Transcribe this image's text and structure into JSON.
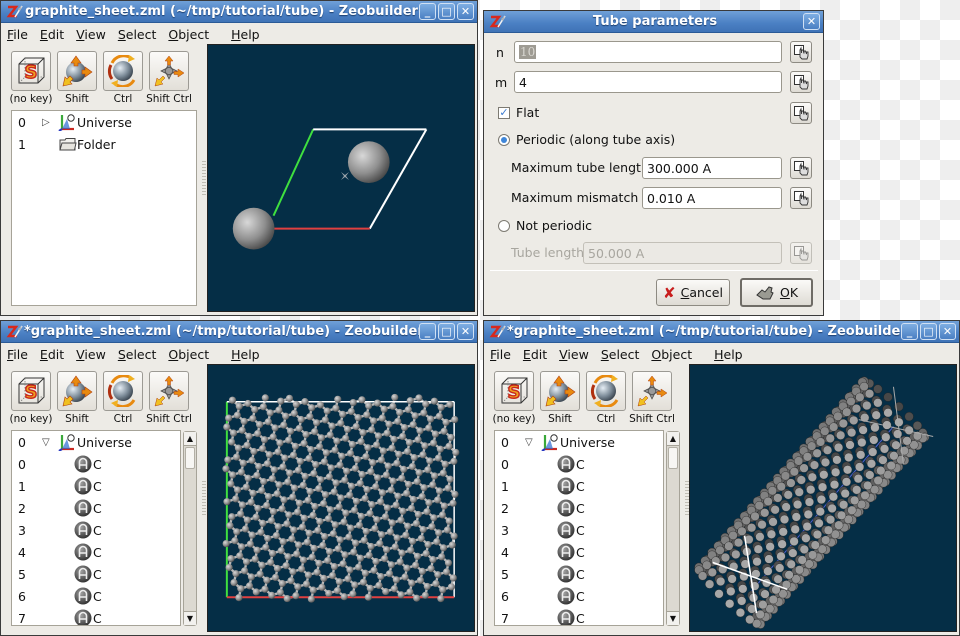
{
  "windows": [
    {
      "id": "main-window-1",
      "title": "graphite_sheet.zml (~/tmp/tutorial/tube) - Zeobuilder",
      "menu": [
        "File",
        "Edit",
        "View",
        "Select",
        "Object",
        "Help"
      ],
      "menu_mnemonics": [
        "F",
        "E",
        "V",
        "S",
        "O",
        "H"
      ],
      "tools": [
        {
          "label": "(no key)",
          "icon": "selection-box-icon"
        },
        {
          "label": "Shift",
          "icon": "translate-sphere-icon"
        },
        {
          "label": "Ctrl",
          "icon": "rotate-sphere-icon"
        },
        {
          "label": "Shift Ctrl",
          "icon": "move-cross-icon"
        }
      ],
      "tree": [
        {
          "index": "0",
          "label": "Universe",
          "icon": "universe-axes-icon",
          "expander": "collapsed"
        },
        {
          "index": "1",
          "label": "Folder",
          "icon": "folder-icon",
          "expander": "none"
        }
      ],
      "viewport": {
        "scene": "unit cell with two atoms",
        "background": "#052e46"
      }
    },
    {
      "id": "main-window-2",
      "title": "*graphite_sheet.zml (~/tmp/tutorial/tube) - Zeobuilder",
      "menu": [
        "File",
        "Edit",
        "View",
        "Select",
        "Object",
        "Help"
      ],
      "menu_mnemonics": [
        "F",
        "E",
        "V",
        "S",
        "O",
        "H"
      ],
      "tools": [
        {
          "label": "(no key)",
          "icon": "selection-box-icon"
        },
        {
          "label": "Shift",
          "icon": "translate-sphere-icon"
        },
        {
          "label": "Ctrl",
          "icon": "rotate-sphere-icon"
        },
        {
          "label": "Shift Ctrl",
          "icon": "move-cross-icon"
        }
      ],
      "tree": [
        {
          "index": "0",
          "label": "Universe",
          "icon": "universe-axes-icon",
          "expander": "expanded"
        },
        {
          "index": "0",
          "label": "C",
          "icon": "atom-icon"
        },
        {
          "index": "1",
          "label": "C",
          "icon": "atom-icon"
        },
        {
          "index": "2",
          "label": "C",
          "icon": "atom-icon"
        },
        {
          "index": "3",
          "label": "C",
          "icon": "atom-icon"
        },
        {
          "index": "4",
          "label": "C",
          "icon": "atom-icon"
        },
        {
          "index": "5",
          "label": "C",
          "icon": "atom-icon"
        },
        {
          "index": "6",
          "label": "C",
          "icon": "atom-icon"
        },
        {
          "index": "7",
          "label": "C",
          "icon": "atom-icon"
        }
      ],
      "viewport": {
        "scene": "flat graphene sheet",
        "background": "#052e46"
      }
    },
    {
      "id": "main-window-3",
      "title": "*graphite_sheet.zml (~/tmp/tutorial/tube) - Zeobuilder",
      "menu": [
        "File",
        "Edit",
        "View",
        "Select",
        "Object",
        "Help"
      ],
      "menu_mnemonics": [
        "F",
        "E",
        "V",
        "S",
        "O",
        "H"
      ],
      "tools": [
        {
          "label": "(no key)",
          "icon": "selection-box-icon"
        },
        {
          "label": "Shift",
          "icon": "translate-sphere-icon"
        },
        {
          "label": "Ctrl",
          "icon": "rotate-sphere-icon"
        },
        {
          "label": "Shift Ctrl",
          "icon": "move-cross-icon"
        }
      ],
      "tree": [
        {
          "index": "0",
          "label": "Universe",
          "icon": "universe-axes-icon",
          "expander": "expanded"
        },
        {
          "index": "0",
          "label": "C",
          "icon": "atom-icon"
        },
        {
          "index": "1",
          "label": "C",
          "icon": "atom-icon"
        },
        {
          "index": "2",
          "label": "C",
          "icon": "atom-icon"
        },
        {
          "index": "3",
          "label": "C",
          "icon": "atom-icon"
        },
        {
          "index": "4",
          "label": "C",
          "icon": "atom-icon"
        },
        {
          "index": "5",
          "label": "C",
          "icon": "atom-icon"
        },
        {
          "index": "6",
          "label": "C",
          "icon": "atom-icon"
        },
        {
          "index": "7",
          "label": "C",
          "icon": "atom-icon"
        }
      ],
      "viewport": {
        "scene": "carbon nanotube",
        "background": "#052e46"
      }
    }
  ],
  "dialog": {
    "title": "Tube parameters",
    "n": {
      "label": "n",
      "value": "10",
      "selected": true
    },
    "m": {
      "label": "m",
      "value": "4"
    },
    "flat": {
      "label": "Flat",
      "checked": true
    },
    "periodic": {
      "label": "Periodic (along tube axis)",
      "selected": true
    },
    "max_tube_length": {
      "label": "Maximum tube length",
      "value": "300.000 A"
    },
    "max_mismatch": {
      "label": "Maximum mismatch",
      "value": "0.010 A"
    },
    "not_periodic": {
      "label": "Not periodic",
      "selected": false
    },
    "tube_length": {
      "label": "Tube length",
      "value": "50.000 A",
      "disabled": true
    },
    "cancel_label": "Cancel",
    "cancel_mnemonic": "C",
    "ok_label": "OK",
    "ok_mnemonic": "O"
  },
  "window_buttons": {
    "minimize": "_",
    "maximize": "□",
    "close": "✕"
  }
}
